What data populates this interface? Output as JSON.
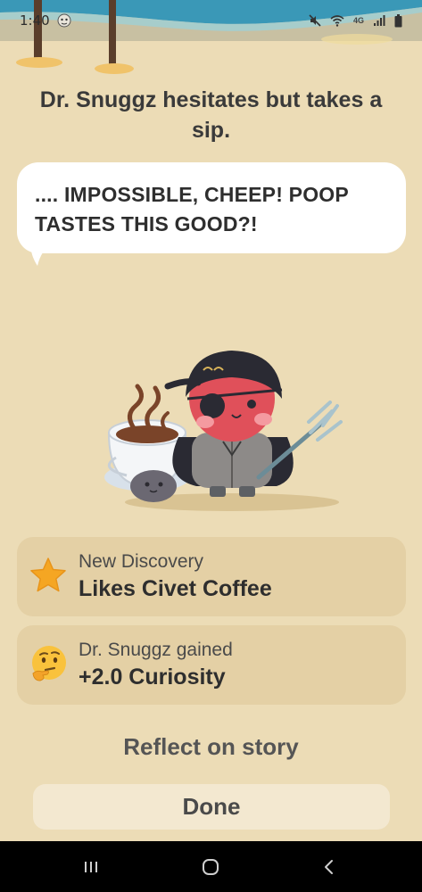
{
  "status_bar": {
    "time": "1:40",
    "network_type": "4G"
  },
  "story": {
    "narration": "Dr. Snuggz hesitates but takes a sip.",
    "speech": ".... IMPOSSIBLE, CHEEP! POOP TASTES THIS GOOD?!"
  },
  "cards": {
    "discovery": {
      "icon": "star-icon",
      "label": "New Discovery",
      "value": "Likes Civet Coffee"
    },
    "gained": {
      "icon": "thinking-face-icon",
      "label": "Dr. Snuggz gained",
      "value": "+2.0 Curiosity"
    }
  },
  "actions": {
    "reflect_label": "Reflect on story",
    "done_label": "Done"
  },
  "colors": {
    "background": "#ecdcb6",
    "card": "#e4d0a5",
    "button": "#f3e8d0",
    "sea": "#3a98b7",
    "star": "#f5a623"
  }
}
